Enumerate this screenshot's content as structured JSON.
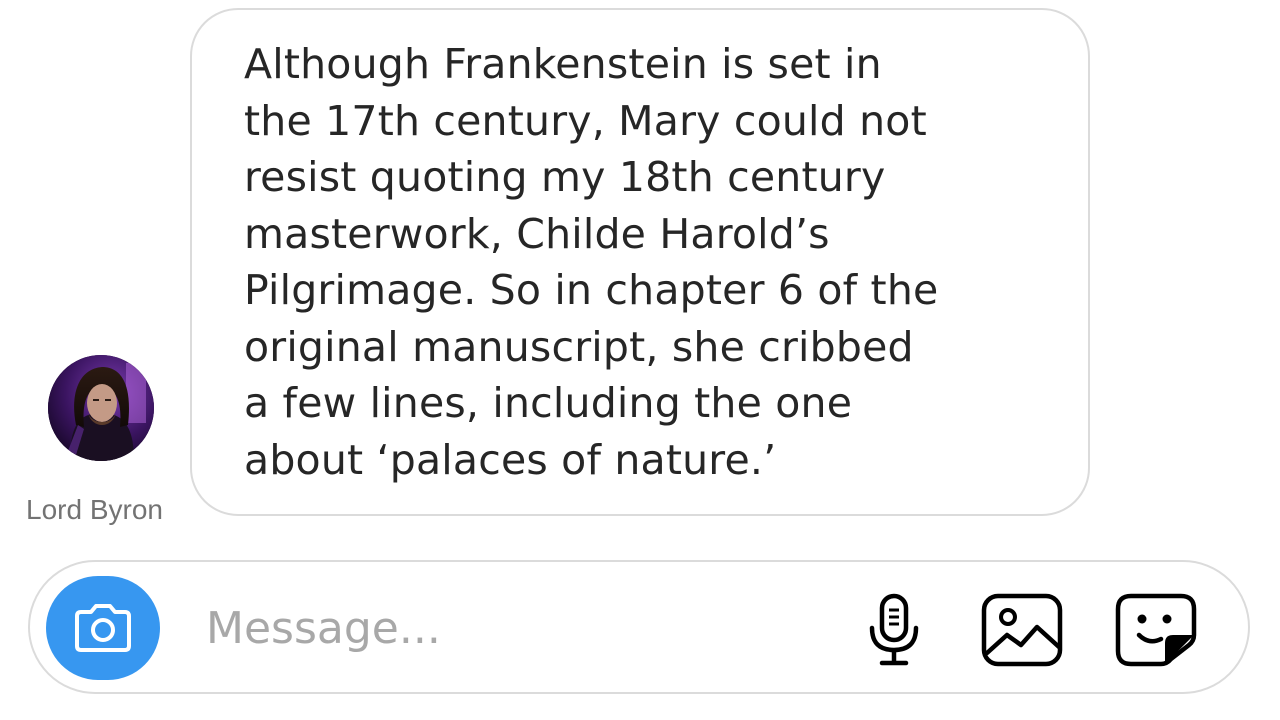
{
  "message": {
    "lines": [
      "Although Frankenstein is set in",
      "the 17th century, Mary could not",
      "resist quoting my 18th century",
      "masterwork, Childe Harold’s",
      "Pilgrimage. So in chapter 6 of the",
      "original manuscript, she cribbed",
      "a few lines, including the one",
      "about ‘palaces of nature.’"
    ]
  },
  "sender": {
    "name": "Lord Byron"
  },
  "composer": {
    "placeholder": "Message...",
    "camera_icon": "camera-icon",
    "mic_icon": "microphone-icon",
    "gallery_icon": "gallery-icon",
    "sticker_icon": "sticker-icon"
  },
  "colors": {
    "accent": "#3797f0",
    "text": "#262626",
    "muted": "#737373",
    "placeholder": "#a8a8a8",
    "border": "#dbdbdb"
  }
}
